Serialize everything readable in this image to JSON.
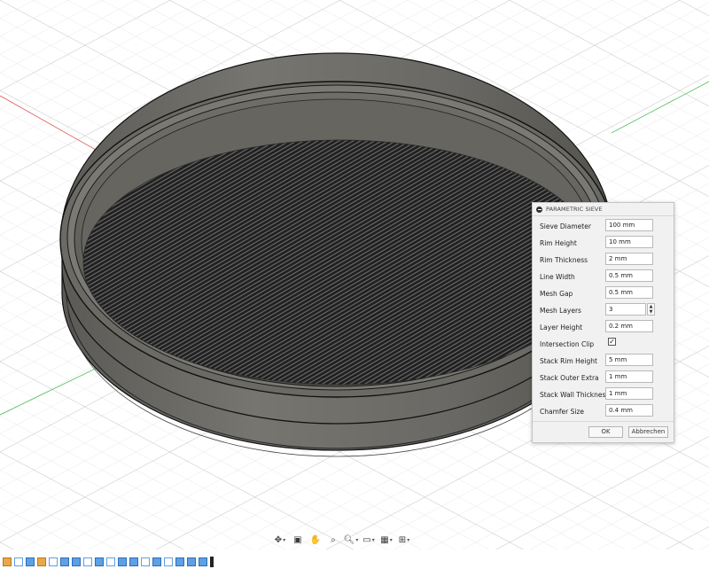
{
  "colors": {
    "accent": "#5ea0e4",
    "grid": "#cfcfcf",
    "axis_x": "#e05555",
    "axis_z": "#55c060"
  },
  "dialog": {
    "title": "PARAMETRIC SIEVE",
    "fields": [
      {
        "label": "Sieve Diameter",
        "value": "100 mm"
      },
      {
        "label": "Rim Height",
        "value": "10 mm"
      },
      {
        "label": "Rim Thickness",
        "value": "2 mm"
      },
      {
        "label": "Line Width",
        "value": "0.5 mm"
      },
      {
        "label": "Mesh Gap",
        "value": "0.5 mm"
      },
      {
        "label": "Mesh Layers",
        "value": "3"
      },
      {
        "label": "Layer Height",
        "value": "0.2 mm"
      },
      {
        "label": "Intersection Clip",
        "value": "✓"
      },
      {
        "label": "Stack Rim Height",
        "value": "5 mm"
      },
      {
        "label": "Stack Outer Extra",
        "value": "1 mm"
      },
      {
        "label": "Stack Wall Thickness",
        "value": "1 mm"
      },
      {
        "label": "Chamfer Size",
        "value": "0.4 mm"
      }
    ],
    "ok_label": "OK",
    "cancel_label": "Abbrechen"
  },
  "nav_toolbar": {
    "icons": [
      "orbit-icon",
      "look-at-icon",
      "pan-icon",
      "zoom-window-icon",
      "zoom-icon",
      "display-settings-icon",
      "grid-settings-icon",
      "viewports-icon"
    ]
  },
  "timeline": {
    "count": 19
  }
}
